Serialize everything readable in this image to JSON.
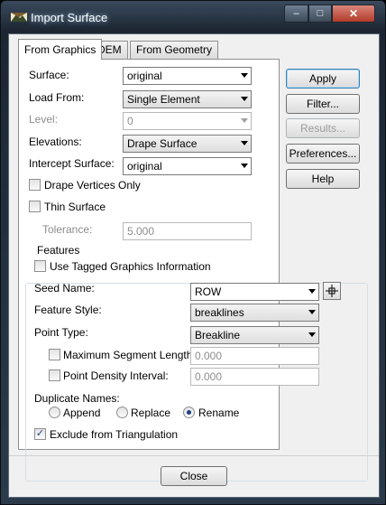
{
  "window": {
    "title": "Import Surface",
    "minimize": "–",
    "maximize": "□",
    "close": "✕"
  },
  "tabs": [
    {
      "label": "From Graphics",
      "active": true
    },
    {
      "label": "DEM"
    },
    {
      "label": "From Geometry"
    }
  ],
  "form": {
    "surface": {
      "label": "Surface:",
      "value": "original"
    },
    "load_from": {
      "label": "Load From:",
      "value": "Single Element"
    },
    "level": {
      "label": "Level:",
      "value": "0"
    },
    "elevations": {
      "label": "Elevations:",
      "value": "Drape Surface"
    },
    "intercept_surface": {
      "label": "Intercept Surface:",
      "value": "original"
    },
    "drape_vertices_only": {
      "label": "Drape Vertices Only",
      "checked": false
    },
    "thin_surface": {
      "label": "Thin Surface",
      "checked": false
    },
    "tolerance": {
      "label": "Tolerance:",
      "value": "5.000"
    }
  },
  "features": {
    "legend": "Features",
    "use_tagged": {
      "label": "Use Tagged Graphics Information",
      "checked": false
    },
    "seed_name": {
      "label": "Seed Name:",
      "value": "ROW"
    },
    "feature_style": {
      "label": "Feature Style:",
      "value": "breaklines"
    },
    "point_type": {
      "label": "Point Type:",
      "value": "Breakline"
    },
    "max_segment_length": {
      "label": "Maximum Segment Length:",
      "value": "0.000",
      "checked": false
    },
    "point_density": {
      "label": "Point Density Interval:",
      "value": "0.000",
      "checked": false
    },
    "duplicate_names": {
      "label": "Duplicate Names:",
      "options": [
        {
          "label": "Append",
          "selected": false
        },
        {
          "label": "Replace",
          "selected": false
        },
        {
          "label": "Rename",
          "selected": true
        }
      ]
    },
    "exclude_triangulation": {
      "label": "Exclude from Triangulation",
      "checked": true
    }
  },
  "side_buttons": {
    "apply": "Apply",
    "filter": "Filter...",
    "results": "Results...",
    "preferences": "Preferences...",
    "help": "Help"
  },
  "close_button": "Close",
  "icons": {
    "seed_pick": "crosshair-icon",
    "check": "✓"
  }
}
